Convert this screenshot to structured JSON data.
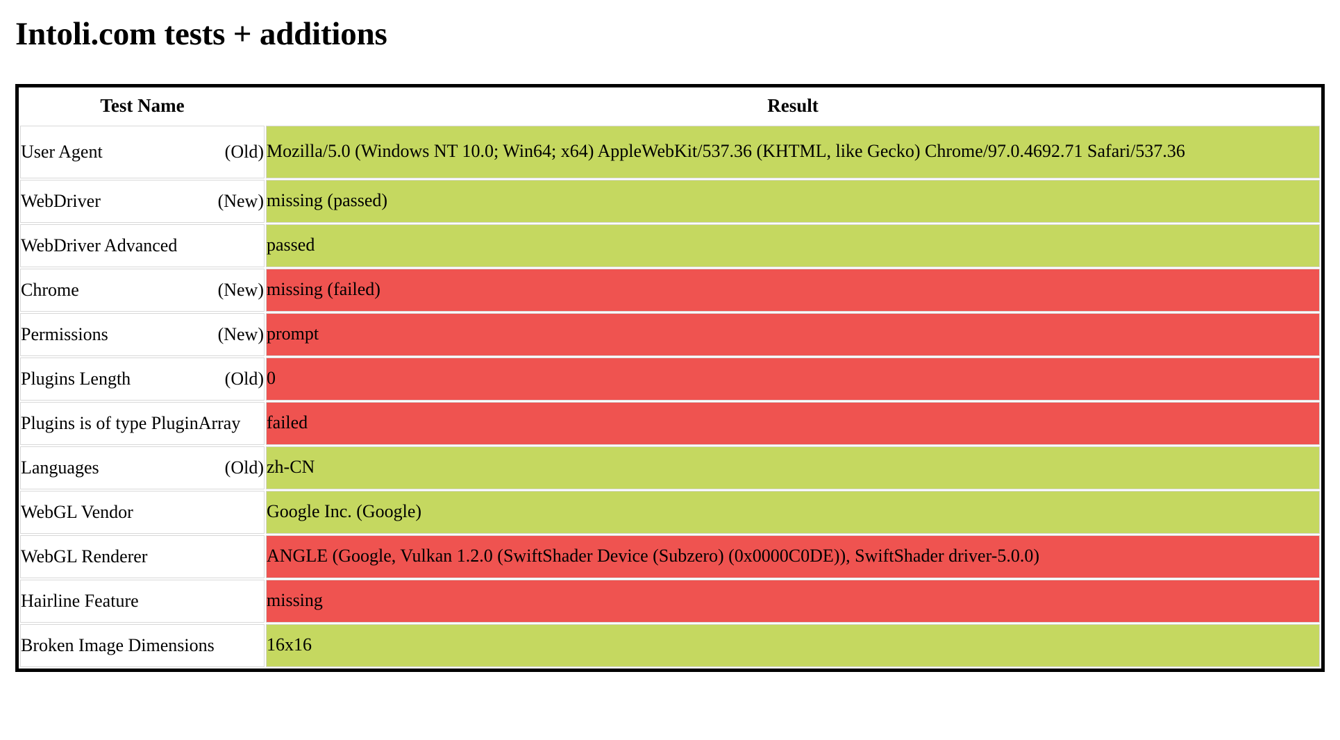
{
  "page": {
    "title": "Intoli.com tests + additions"
  },
  "colors": {
    "pass": "#c5d860",
    "fail": "#ef5350",
    "border": "#000000",
    "cell_border": "#d8d8d8",
    "background": "#ffffff",
    "text": "#000000"
  },
  "table": {
    "headers": {
      "test_name": "Test Name",
      "result": "Result"
    },
    "rows": [
      {
        "name": "User Agent",
        "age": "(Old)",
        "result": "Mozilla/5.0 (Windows NT 10.0; Win64; x64) AppleWebKit/537.36 (KHTML, like Gecko) Chrome/97.0.4692.71 Safari/537.36",
        "status": "pass"
      },
      {
        "name": "WebDriver",
        "age": "(New)",
        "result": "missing (passed)",
        "status": "pass"
      },
      {
        "name": "WebDriver Advanced",
        "age": "",
        "result": "passed",
        "status": "pass"
      },
      {
        "name": "Chrome",
        "age": "(New)",
        "result": "missing (failed)",
        "status": "fail"
      },
      {
        "name": "Permissions",
        "age": "(New)",
        "result": "prompt",
        "status": "fail"
      },
      {
        "name": "Plugins Length",
        "age": "(Old)",
        "result": "0",
        "status": "fail"
      },
      {
        "name": "Plugins is of type PluginArray",
        "age": "",
        "result": "failed",
        "status": "fail"
      },
      {
        "name": "Languages",
        "age": "(Old)",
        "result": "zh-CN",
        "status": "pass"
      },
      {
        "name": "WebGL Vendor",
        "age": "",
        "result": "Google Inc. (Google)",
        "status": "pass"
      },
      {
        "name": "WebGL Renderer",
        "age": "",
        "result": "ANGLE (Google, Vulkan 1.2.0 (SwiftShader Device (Subzero) (0x0000C0DE)), SwiftShader driver-5.0.0)",
        "status": "fail"
      },
      {
        "name": "Hairline Feature",
        "age": "",
        "result": "missing",
        "status": "fail"
      },
      {
        "name": "Broken Image Dimensions",
        "age": "",
        "result": "16x16",
        "status": "pass"
      }
    ]
  }
}
